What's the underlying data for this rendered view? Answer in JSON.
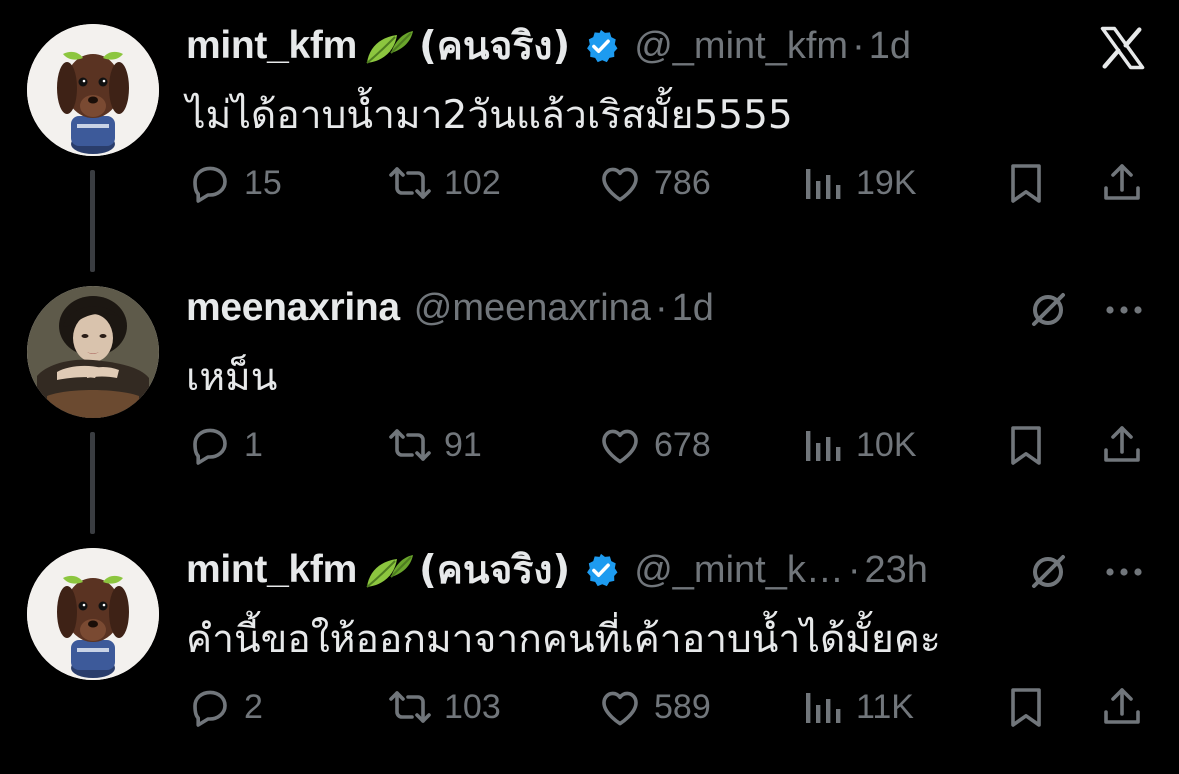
{
  "tweets": [
    {
      "name": "mint_kfm",
      "name_suffix": "(คนจริง)",
      "verified": true,
      "handle": "@_mint_kfm",
      "time": "1d",
      "text": "ไม่ได้อาบน้ำมา2วันแล้วเริสมั้ย5555",
      "replies": "15",
      "reposts": "102",
      "likes": "786",
      "views": "19K"
    },
    {
      "name": "meenaxrina",
      "handle": "@meenaxrina",
      "time": "1d",
      "text": "เหม็น",
      "replies": "1",
      "reposts": "91",
      "likes": "678",
      "views": "10K"
    },
    {
      "name": "mint_kfm",
      "name_suffix": "(คนจริง)",
      "verified": true,
      "handle": "@_mint_k…",
      "time": "23h",
      "text": "คำนี้ขอให้ออกมาจากคนที่เค้าอาบน้ำได้มั้ยคะ",
      "replies": "2",
      "reposts": "103",
      "likes": "589",
      "views": "11K"
    }
  ],
  "separator": "·",
  "icons": {
    "logo": "x-logo-icon",
    "reply": "reply-icon",
    "repost": "repost-icon",
    "like": "heart-icon",
    "views": "views-chart-icon",
    "bookmark": "bookmark-icon",
    "share": "share-icon",
    "grok": "grok-icon",
    "more": "more-icon"
  },
  "colors": {
    "background": "#000000",
    "text": "#e7e9ea",
    "muted": "#71767b",
    "verified": "#1d9bf0",
    "leaf": "#8cc63f"
  }
}
